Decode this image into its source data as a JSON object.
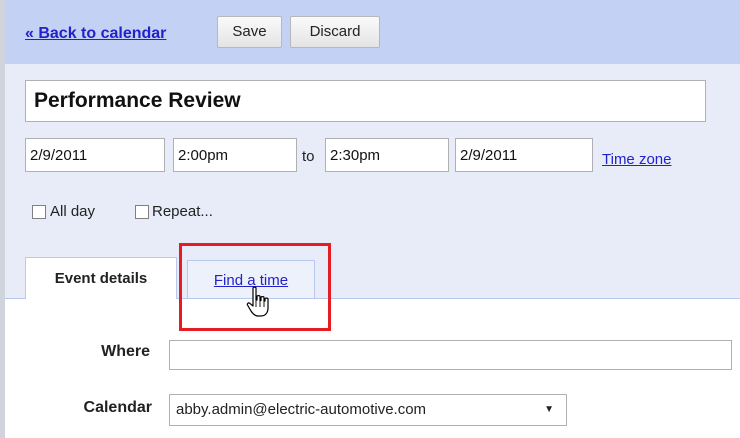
{
  "toolbar": {
    "back_link": "« Back to calendar",
    "save_label": "Save",
    "discard_label": "Discard"
  },
  "event": {
    "title": "Performance Review",
    "start_date": "2/9/2011",
    "start_time": "2:00pm",
    "to_label": "to",
    "end_time": "2:30pm",
    "end_date": "2/9/2011",
    "time_zone_link": "Time zone",
    "all_day_label": "All day",
    "repeat_label": "Repeat...",
    "all_day_checked": false,
    "repeat_checked": false
  },
  "tabs": [
    {
      "label": "Event details",
      "active": true
    },
    {
      "label": "Find a time",
      "active": false
    }
  ],
  "details": {
    "where_label": "Where",
    "where_value": "",
    "calendar_label": "Calendar",
    "calendar_value": "abby.admin@electric-automotive.com"
  },
  "colors": {
    "toolbar_bg": "#c3d1f5",
    "panel_bg": "#e8ecf9",
    "link": "#2222cc",
    "highlight": "#e51c23"
  },
  "icons": {
    "cursor": "hand-pointer-icon",
    "dropdown": "dropdown-arrow-icon"
  }
}
